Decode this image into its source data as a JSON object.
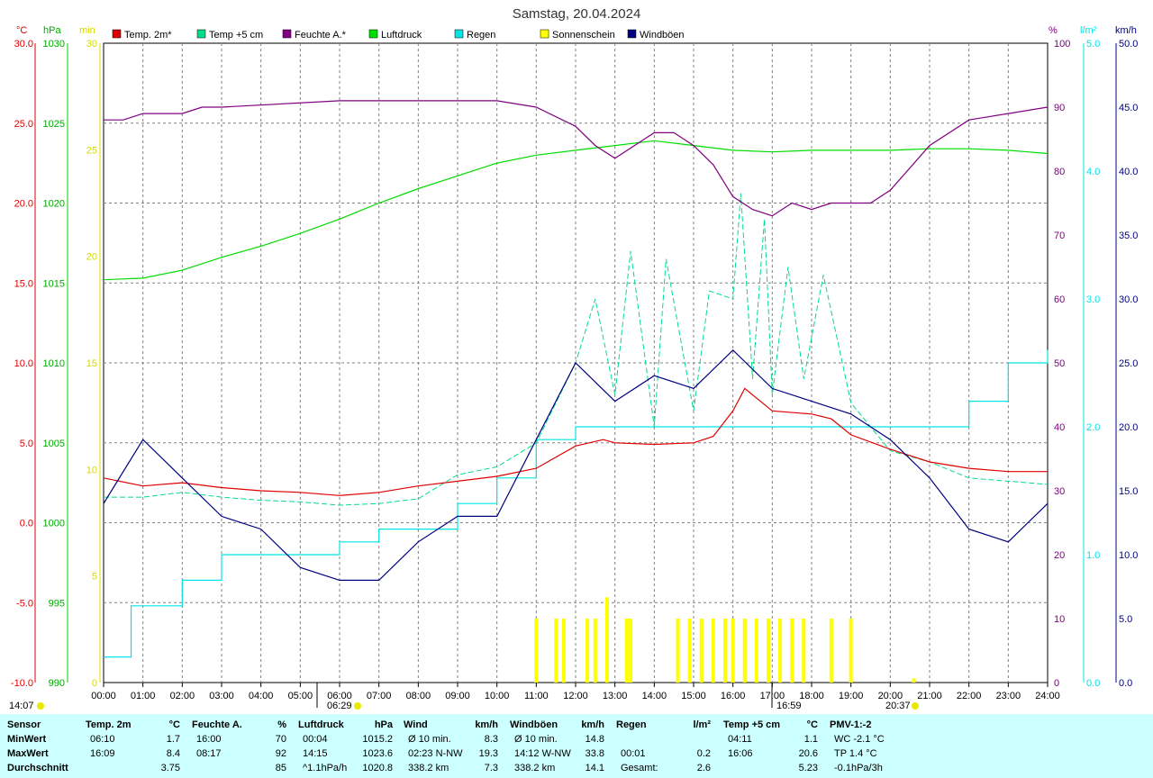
{
  "title": "Samstag, 20.04.2024",
  "colors": {
    "temp": "#e00000",
    "temp5": "#00dd88",
    "humidity": "#800080",
    "pressure": "#00dd00",
    "rain": "#00e5e5",
    "sun": "#ffff00",
    "gust": "#000080",
    "grid": "#808080",
    "stats_bg": "#ccffff"
  },
  "axis_units": {
    "temp": "°C",
    "pressure": "hPa",
    "sun": "min",
    "humidity": "%",
    "rain": "l/m²",
    "wind": "km/h"
  },
  "legend": [
    {
      "label": "Temp. 2m*",
      "color": "#e00000"
    },
    {
      "label": "Temp +5 cm",
      "color": "#00dd88"
    },
    {
      "label": "Feuchte A.*",
      "color": "#800080"
    },
    {
      "label": "Luftdruck",
      "color": "#00dd00"
    },
    {
      "label": "Regen",
      "color": "#00e5e5"
    },
    {
      "label": "Sonnenschein",
      "color": "#ffff00"
    },
    {
      "label": "Windböen",
      "color": "#000080"
    }
  ],
  "sun_events": {
    "moonset": "14:07",
    "sunrise": "06:29",
    "moonrise": "16:59",
    "sunset": "20:37"
  },
  "chart_data": {
    "type": "line",
    "x_ticks": [
      "00:00",
      "01:00",
      "02:00",
      "03:00",
      "04:00",
      "05:00",
      "06:00",
      "07:00",
      "08:00",
      "09:00",
      "10:00",
      "11:00",
      "12:00",
      "13:00",
      "14:00",
      "15:00",
      "16:00",
      "17:00",
      "18:00",
      "19:00",
      "20:00",
      "21:00",
      "22:00",
      "23:00",
      "24:00"
    ],
    "axes": {
      "temp": {
        "range": [
          -10,
          30
        ],
        "ticks": [
          "30.0",
          "25.0",
          "20.0",
          "15.0",
          "10.0",
          "5.0",
          "0.0",
          "-5.0",
          "-10.0"
        ]
      },
      "pressure": {
        "range": [
          990,
          1030
        ],
        "ticks": [
          "1030",
          "1025",
          "1020",
          "1015",
          "1010",
          "1005",
          "1000",
          "995",
          "990"
        ]
      },
      "sun": {
        "range": [
          0,
          30
        ],
        "ticks": [
          "30",
          "25",
          "20",
          "15",
          "10",
          "5",
          "0"
        ]
      },
      "humidity": {
        "range": [
          0,
          100
        ],
        "ticks": [
          "100",
          "90",
          "80",
          "70",
          "60",
          "50",
          "40",
          "30",
          "20",
          "10",
          "0"
        ]
      },
      "rain": {
        "range": [
          0,
          5
        ],
        "ticks": [
          "5.0",
          "4.0",
          "3.0",
          "2.0",
          "1.0",
          "0.0"
        ]
      },
      "wind": {
        "range": [
          0,
          50
        ],
        "ticks": [
          "50.0",
          "45.0",
          "40.0",
          "35.0",
          "30.0",
          "25.0",
          "20.0",
          "15.0",
          "10.0",
          "5.0",
          "0.0"
        ]
      }
    },
    "series": [
      {
        "name": "Temp. 2m*",
        "axis": "temp",
        "x": [
          0,
          1,
          2,
          3,
          4,
          5,
          6,
          7,
          8,
          9,
          10,
          11,
          12,
          12.7,
          13,
          14,
          15,
          15.5,
          16,
          16.3,
          17,
          18,
          18.5,
          19,
          20,
          21,
          22,
          23,
          24
        ],
        "y": [
          2.8,
          2.3,
          2.5,
          2.2,
          2.0,
          1.9,
          1.7,
          1.9,
          2.3,
          2.6,
          2.9,
          3.4,
          4.8,
          5.2,
          5.0,
          4.9,
          5.0,
          5.4,
          7.0,
          8.4,
          7.0,
          6.8,
          6.5,
          5.5,
          4.6,
          3.8,
          3.4,
          3.2,
          3.2
        ]
      },
      {
        "name": "Temp +5 cm",
        "axis": "temp",
        "x": [
          0,
          1,
          2,
          3,
          4,
          5,
          6,
          7,
          8,
          9,
          10,
          11,
          12,
          12.5,
          13,
          13.4,
          14,
          14.3,
          15,
          15.4,
          16,
          16.2,
          16.5,
          16.8,
          17,
          17.4,
          17.8,
          18.3,
          19,
          20,
          21,
          22,
          23,
          24
        ],
        "y": [
          1.6,
          1.6,
          1.9,
          1.6,
          1.4,
          1.3,
          1.1,
          1.2,
          1.5,
          3.0,
          3.5,
          5.0,
          10.0,
          14.0,
          8.0,
          17.0,
          6.0,
          16.5,
          7.0,
          14.5,
          14.0,
          20.6,
          9.0,
          19.0,
          8.0,
          16.0,
          9.0,
          15.5,
          7.5,
          4.5,
          3.8,
          2.8,
          2.6,
          2.4
        ]
      },
      {
        "name": "Feuchte A.*",
        "axis": "humidity",
        "x": [
          0,
          0.5,
          1,
          2,
          2.5,
          3,
          6,
          7,
          10,
          11,
          12,
          12.5,
          13,
          14,
          14.5,
          15,
          15.5,
          16,
          16.5,
          17,
          17.5,
          18,
          18.5,
          19,
          19.5,
          20,
          21,
          22,
          23,
          24
        ],
        "y": [
          88,
          88,
          89,
          89,
          90,
          90,
          91,
          91,
          91,
          90,
          87,
          84,
          82,
          86,
          86,
          84,
          81,
          76,
          74,
          73,
          75,
          74,
          75,
          75,
          75,
          77,
          84,
          88,
          89,
          90
        ]
      },
      {
        "name": "Luftdruck",
        "axis": "pressure",
        "x": [
          0,
          1,
          2,
          3,
          4,
          5,
          6,
          7,
          8,
          9,
          10,
          11,
          12,
          13,
          14,
          15,
          16,
          17,
          18,
          19,
          20,
          21,
          22,
          23,
          24
        ],
        "y": [
          1015.2,
          1015.3,
          1015.8,
          1016.6,
          1017.3,
          1018.1,
          1019.0,
          1020.0,
          1020.9,
          1021.7,
          1022.5,
          1023.0,
          1023.3,
          1023.6,
          1023.9,
          1023.6,
          1023.3,
          1023.2,
          1023.3,
          1023.3,
          1023.3,
          1023.4,
          1023.4,
          1023.3,
          1023.1
        ]
      },
      {
        "name": "Regen",
        "axis": "rain",
        "x": [
          0,
          0.7,
          2,
          3,
          4,
          5,
          6,
          7,
          8,
          9,
          10,
          11,
          12,
          13,
          14,
          15,
          16,
          17,
          18,
          19,
          20,
          21,
          22,
          23,
          24
        ],
        "y": [
          0.2,
          0.6,
          0.8,
          1.0,
          1.0,
          1.0,
          1.1,
          1.2,
          1.2,
          1.4,
          1.6,
          1.9,
          2.0,
          2.0,
          2.0,
          2.0,
          2.0,
          2.0,
          2.0,
          2.0,
          2.0,
          2.0,
          2.2,
          2.5,
          2.6
        ]
      },
      {
        "name": "Windböen",
        "axis": "wind",
        "x": [
          0,
          1,
          2,
          3,
          4,
          5,
          6,
          7,
          8,
          9,
          10,
          11,
          12,
          13,
          14,
          15,
          16,
          17,
          18,
          19,
          20,
          21,
          22,
          23,
          24
        ],
        "y": [
          14,
          19,
          16,
          13,
          12,
          9,
          8,
          8,
          11,
          13,
          13,
          19,
          25,
          22,
          24,
          23,
          26,
          23,
          22,
          21,
          19,
          16,
          12,
          11,
          14
        ]
      },
      {
        "name": "Sonnenschein",
        "axis": "sun",
        "type": "bar",
        "x": [
          11.0,
          11.5,
          11.7,
          12.3,
          12.5,
          12.8,
          13.3,
          13.4,
          14.6,
          14.9,
          15.2,
          15.5,
          15.8,
          16.0,
          16.3,
          16.6,
          16.9,
          17.2,
          17.5,
          17.8,
          18.5,
          19.0,
          20.6
        ],
        "y": [
          3,
          3,
          3,
          3,
          3,
          4,
          3,
          3,
          3,
          3,
          3,
          3,
          3,
          3,
          3,
          3,
          3,
          3,
          3,
          3,
          3,
          3,
          0.2
        ]
      }
    ]
  },
  "stats": {
    "headers": [
      {
        "label": "Sensor",
        "unit": ""
      },
      {
        "label": "Temp. 2m",
        "unit": "°C"
      },
      {
        "label": "Feuchte A.",
        "unit": "%"
      },
      {
        "label": "Luftdruck",
        "unit": "hPa"
      },
      {
        "label": "Wind",
        "unit": "km/h"
      },
      {
        "label": "Windböen",
        "unit": "km/h"
      },
      {
        "label": "Regen",
        "unit": "l/m²"
      },
      {
        "label": "Temp +5 cm",
        "unit": "°C"
      },
      {
        "label": "PMV-1:-2",
        "unit": ""
      }
    ],
    "rows": [
      {
        "label": "MinWert",
        "cells": [
          [
            "06:10",
            "1.7"
          ],
          [
            "16:00",
            "70"
          ],
          [
            "00:04",
            "1015.2"
          ],
          [
            "Ø 10 min.",
            "8.3"
          ],
          [
            "Ø 10 min.",
            "14.8"
          ],
          [
            "",
            ""
          ],
          [
            "04:11",
            "1.1"
          ],
          [
            "WC -2.1 °C",
            ""
          ]
        ]
      },
      {
        "label": "MaxWert",
        "cells": [
          [
            "16:09",
            "8.4"
          ],
          [
            "08:17",
            "92"
          ],
          [
            "14:15",
            "1023.6"
          ],
          [
            "02:23   N-NW",
            "19.3"
          ],
          [
            "14:12   W-NW",
            "33.8"
          ],
          [
            "00:01",
            "0.2"
          ],
          [
            "16:06",
            "20.6"
          ],
          [
            "TP 1.4 °C",
            ""
          ]
        ]
      },
      {
        "label": "Durchschnitt",
        "cells": [
          [
            "",
            "3.75"
          ],
          [
            "",
            "85"
          ],
          [
            "^1.1hPa/h",
            "1020.8"
          ],
          [
            "338.2 km",
            "7.3"
          ],
          [
            "338.2 km",
            "14.1"
          ],
          [
            "Gesamt:",
            "2.6"
          ],
          [
            "",
            "5.23"
          ],
          [
            "-0.1hPa/3h",
            ""
          ]
        ]
      }
    ]
  }
}
